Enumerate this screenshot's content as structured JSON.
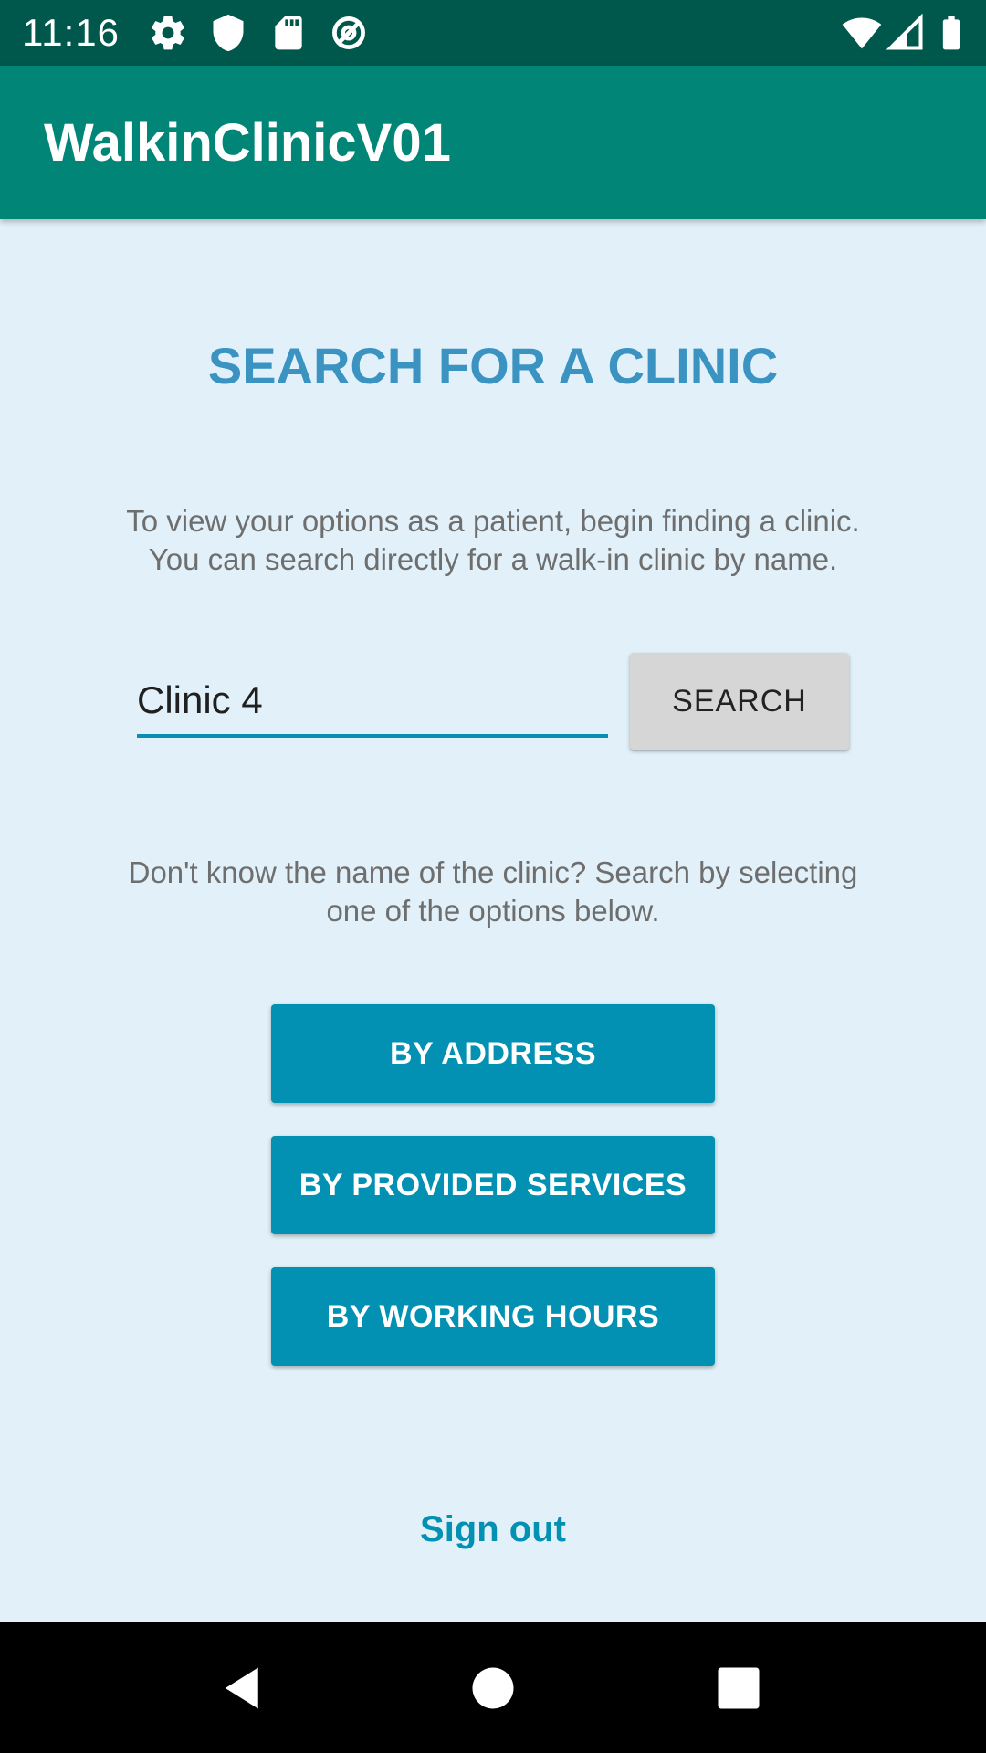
{
  "status_bar": {
    "time": "11:16",
    "icons_left": [
      "settings-icon",
      "shield-icon",
      "sd-card-icon",
      "data-saver-icon"
    ],
    "icons_right": [
      "wifi-icon",
      "signal-icon",
      "battery-icon"
    ]
  },
  "app_bar": {
    "title": "WalkinClinicV01"
  },
  "main": {
    "heading": "SEARCH FOR A CLINIC",
    "intro_line1": "To view your options as a patient, begin finding a clinic.",
    "intro_line2": "You can search directly for a walk-in clinic by name.",
    "search": {
      "value": "Clinic 4",
      "button_label": "SEARCH"
    },
    "alt_line1": "Don't know the name of the clinic? Search by selecting",
    "alt_line2": "one of the options below.",
    "options": [
      {
        "label": "BY ADDRESS"
      },
      {
        "label": "BY PROVIDED SERVICES"
      },
      {
        "label": "BY WORKING HOURS"
      }
    ],
    "sign_out_label": "Sign out"
  },
  "nav_bar": {
    "buttons": [
      "back-icon",
      "home-icon",
      "recents-icon"
    ]
  },
  "colors": {
    "status_bar": "#00574b",
    "app_bar": "#008577",
    "background": "#e2f1f9",
    "heading": "#3b93c2",
    "accent": "#0291b2"
  }
}
